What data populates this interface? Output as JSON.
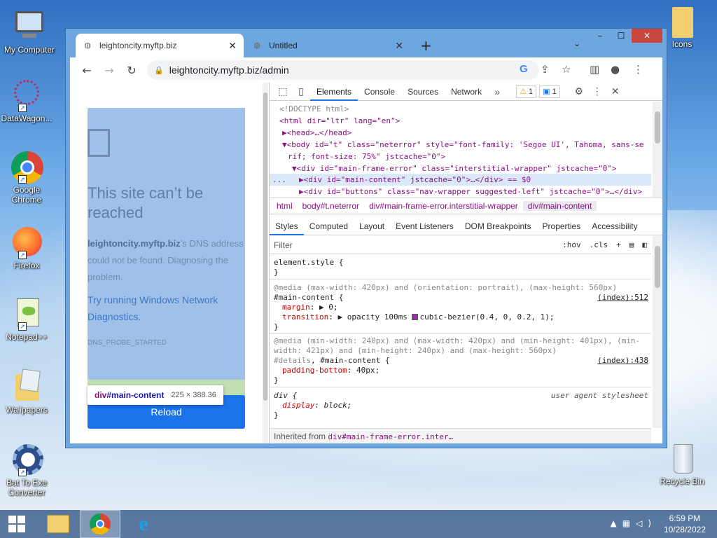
{
  "desktop": {
    "icons": [
      {
        "name": "my-computer",
        "label": "My Computer"
      },
      {
        "name": "datawagon",
        "label": "DataWagon..."
      },
      {
        "name": "google-chrome",
        "label": "Google Chrome"
      },
      {
        "name": "firefox",
        "label": "Firefox"
      },
      {
        "name": "notepadpp",
        "label": "Notepad++"
      },
      {
        "name": "wallpapers",
        "label": "Wallpapers"
      },
      {
        "name": "bat-to-exe",
        "label": "Bat To Exe Converter"
      },
      {
        "name": "icons",
        "label": "Icons"
      },
      {
        "name": "recycle-bin",
        "label": "Recycle Bin"
      }
    ]
  },
  "browser": {
    "tabs": [
      {
        "title": "leightoncity.myftp.biz",
        "active": true
      },
      {
        "title": "Untitled",
        "active": false
      }
    ],
    "url": "leightoncity.myftp.biz/admin",
    "window_controls": {
      "minimize": "–",
      "maximize": "☐",
      "close": "✕"
    }
  },
  "page": {
    "heading": "This site can’t be reached",
    "host": "leightoncity.myftp.biz",
    "dns_text": "’s DNS address could not be found. Diagnosing the problem.",
    "suggestion": "Try running Windows Network Diagnostics.",
    "error_code": "DNS_PROBE_STARTED",
    "reload_label": "Reload",
    "tooltip": {
      "selector": "div",
      "id": "#main-content",
      "dims": "225 × 388.36"
    }
  },
  "devtools": {
    "tabs": [
      "Elements",
      "Console",
      "Sources",
      "Network"
    ],
    "more": "»",
    "warn_badge": "1",
    "info_badge": "1",
    "dom": [
      "<!DOCTYPE html>",
      "<html dir=\"ltr\" lang=\"en\">",
      "▶<head>…</head>",
      "▼<body id=\"t\" class=\"neterror\" style=\"font-family: 'Segoe UI', Tahoma, sans-se",
      "rif; font-size: 75%\" jstcache=\"0\">",
      "▼<div id=\"main-frame-error\" class=\"interstitial-wrapper\" jstcache=\"0\">",
      "▶<div id=\"main-content\" jstcache=\"0\">…</div> == $0",
      "▶<div id=\"buttons\" class=\"nav-wrapper suggested-left\" jstcache=\"0\">…</div>"
    ],
    "dots": "...",
    "breadcrumbs": [
      "html",
      "body#t.neterror",
      "div#main-frame-error.interstitial-wrapper",
      "div#main-content"
    ],
    "style_tabs": [
      "Styles",
      "Computed",
      "Layout",
      "Event Listeners",
      "DOM Breakpoints",
      "Properties",
      "Accessibility"
    ],
    "filter_placeholder": "Filter",
    "hov": ":hov",
    "cls": ".cls",
    "rules": {
      "element_style": "element.style {",
      "close": "}",
      "media1": "@media (max-width: 420px) and (orientation: portrait), (max-height: 560px)",
      "sel1": "#main-content {",
      "src1": "(index):512",
      "p1_name": "margin",
      "p1_val": "▶ 0;",
      "p2_name": "transition",
      "p2_val": "▶ opacity 100ms ",
      "p2_fn": "cubic-bezier(0.4, 0, 0.2, 1);",
      "media2a": "@media (min-width: 240px) and (max-width: 420px) and (min-height: 401px), (min-",
      "media2b": "width: 421px) and (min-height: 240px) and (max-height: 560px)",
      "sel2a": "#details",
      "sel2b": ", #main-content {",
      "src2": "(index):438",
      "p3_name": "padding-bottom",
      "p3_val": " 40px;",
      "sel3": "div {",
      "ua": "user agent stylesheet",
      "p4_name": "display",
      "p4_val": " block;"
    },
    "inherited_label": "Inherited from ",
    "inherited_value": "div#main-frame-error.inter…"
  },
  "taskbar": {
    "time": "6:59 PM",
    "date": "10/28/2022"
  }
}
